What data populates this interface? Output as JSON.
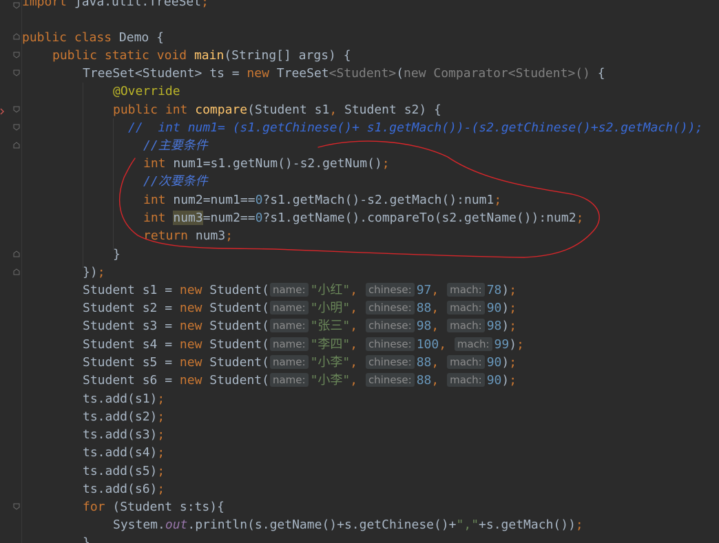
{
  "editor": {
    "lines": {
      "l0": {
        "kw": "import",
        "rest": " java.util.TreeSet",
        "semi": ";"
      },
      "l2": {
        "kw1": "public",
        "kw2": "class",
        "name": " Demo {"
      },
      "l3": {
        "kw1": "public",
        "kw2": "static",
        "kw3": "void",
        "fn": "main",
        "rest": "(String[] args) {"
      },
      "l4": {
        "a": "TreeSet<Student> ts = ",
        "kw": "new",
        "b": " TreeSet",
        "g1": "<Student>",
        "c": "(",
        "g2": "new Comparator<Student>()",
        "d": " {"
      },
      "l5": {
        "an": "@Override"
      },
      "l6": {
        "kw1": "public",
        "kw2": "int",
        "fn": "compare",
        "a": "(Student s1",
        "comma": ",",
        "b": " Student s2) {"
      },
      "l7": {
        "text": "//  int num1= (s1.getChinese()+ s1.getMach())-(s2.getChinese()+s2.getMach());"
      },
      "l8": {
        "text": "//主要条件"
      },
      "l9": {
        "kw": "int",
        "a": " num1=s1.getNum()-s2.getNum()",
        "semi": ";"
      },
      "l10": {
        "text": "//次要条件"
      },
      "l11": {
        "kw": "int",
        "a": " num2=num1==",
        "n": "0",
        "b": "?s1.getMach()-s2.getMach():num1",
        "semi": ";"
      },
      "l12": {
        "kw": "int",
        "hl": "num3",
        "a": "=num2==",
        "n": "0",
        "b": "?s1.getName().compareTo(s2.getName()):num2",
        "semi": ";"
      },
      "l13": {
        "kw": "return",
        "a": " num3",
        "semi": ";"
      },
      "l14": {
        "a": "}"
      },
      "l15": {
        "a": "})",
        "semi": ";"
      }
    },
    "students": [
      {
        "var": "s1",
        "name": "\"小红\"",
        "chinese": "97",
        "mach": "78"
      },
      {
        "var": "s2",
        "name": "\"小明\"",
        "chinese": "88",
        "mach": "90"
      },
      {
        "var": "s3",
        "name": "\"张三\"",
        "chinese": "98",
        "mach": "98"
      },
      {
        "var": "s4",
        "name": "\"李四\"",
        "chinese": "100",
        "mach": "99"
      },
      {
        "var": "s5",
        "name": "\"小李\"",
        "chinese": "88",
        "mach": "90"
      },
      {
        "var": "s6",
        "name": "\"小李\"",
        "chinese": "88",
        "mach": "90"
      }
    ],
    "student_decl": {
      "type": "Student ",
      "eq": " = ",
      "kw": "new",
      "ctor": " Student(",
      "hint_name": "name:",
      "hint_chinese": "chinese:",
      "hint_mach": "mach:",
      "comma": ",",
      "close": ")",
      "semi": ";"
    },
    "adds": [
      {
        "a": "ts.add(s1)",
        "semi": ";"
      },
      {
        "a": "ts.add(s2)",
        "semi": ";"
      },
      {
        "a": "ts.add(s3)",
        "semi": ";"
      },
      {
        "a": "ts.add(s4)",
        "semi": ";"
      },
      {
        "a": "ts.add(s5)",
        "semi": ";"
      },
      {
        "a": "ts.add(s6)",
        "semi": ";"
      }
    ],
    "for_line": {
      "kw": "for",
      "a": " (Student s:ts){"
    },
    "println_line": {
      "a": "System.",
      "field": "out",
      "b": ".println(s.getName()+s.getChinese()+",
      "str": "\",\"",
      "c": "+s.getMach())",
      "semi": ";"
    },
    "last_line": {
      "a": "}"
    }
  },
  "colors": {
    "background": "#2b2b2b",
    "keyword": "#cc7832",
    "function": "#ffc66d",
    "annotation_stroke": "#d8262a"
  }
}
